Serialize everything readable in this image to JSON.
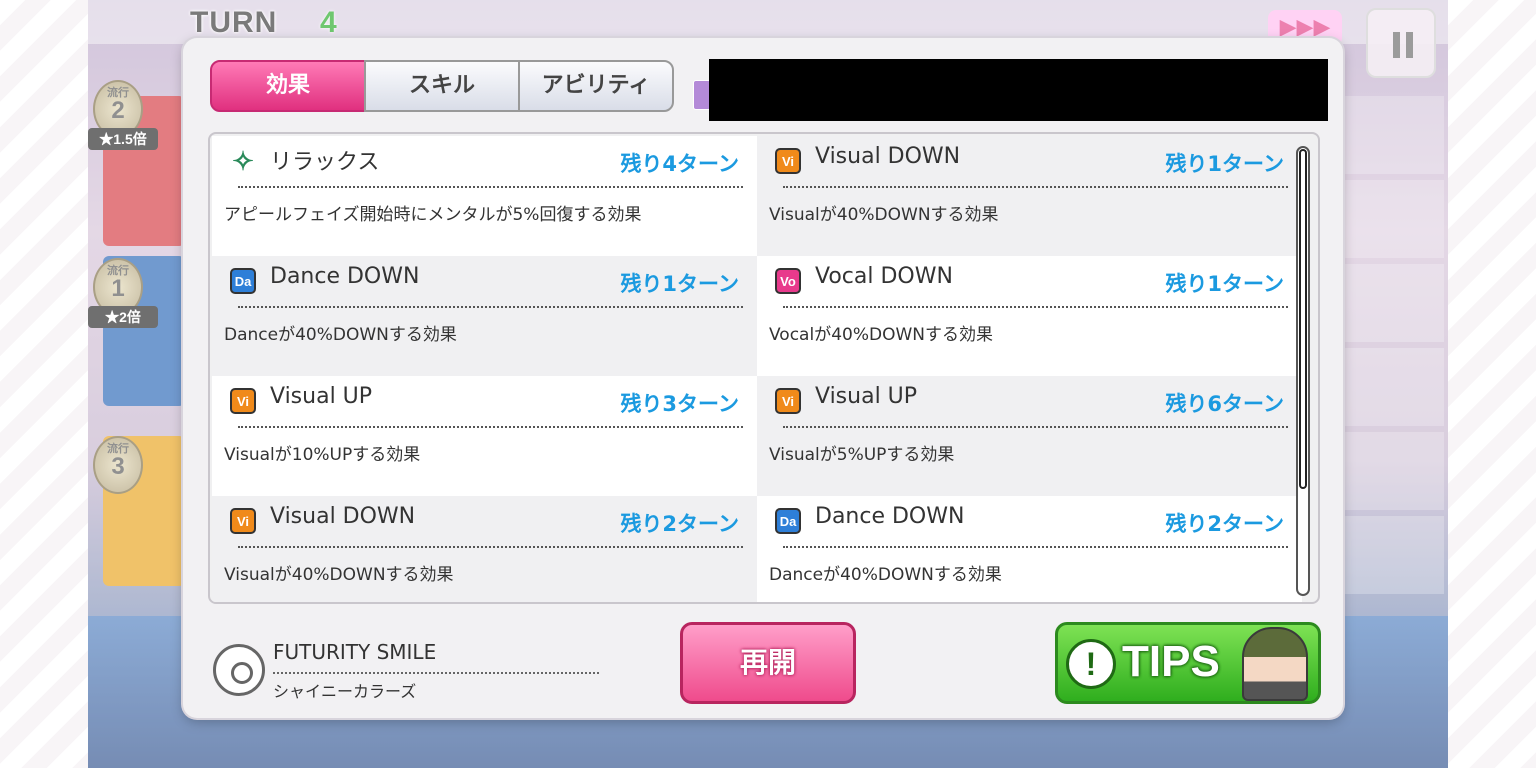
{
  "game": {
    "turn_label": "TURN",
    "turn_number": "4",
    "ffwd_icon": "fast-forward-icon",
    "pause_icon": "pause-icon",
    "trend_label": "流行",
    "slots": [
      {
        "rank": "2",
        "multiplier": "★1.5倍",
        "color": "#d4363e"
      },
      {
        "rank": "1",
        "multiplier": "★2倍",
        "color": "#2664b5"
      },
      {
        "rank": "3",
        "multiplier": "",
        "color": "#e8a219"
      }
    ]
  },
  "modal": {
    "tabs": [
      {
        "label": "効果",
        "active": true
      },
      {
        "label": "スキル",
        "active": false
      },
      {
        "label": "アビリティ",
        "active": false
      }
    ],
    "effects": [
      {
        "icon": "relax-icon",
        "name": "リラックス",
        "turns": "残り4ターン",
        "description": "アピールフェイズ開始時にメンタルが5%回復する効果"
      },
      {
        "icon": "visual-icon",
        "name": "Visual DOWN",
        "turns": "残り1ターン",
        "description": "Visualが40%DOWNする効果"
      },
      {
        "icon": "dance-icon",
        "name": "Dance DOWN",
        "turns": "残り1ターン",
        "description": "Danceが40%DOWNする効果"
      },
      {
        "icon": "vocal-icon",
        "name": "Vocal DOWN",
        "turns": "残り1ターン",
        "description": "Vocalが40%DOWNする効果"
      },
      {
        "icon": "visual-icon",
        "name": "Visual UP",
        "turns": "残り3ターン",
        "description": "Visualが10%UPする効果"
      },
      {
        "icon": "visual-icon",
        "name": "Visual UP",
        "turns": "残り6ターン",
        "description": "Visualが5%UPする効果"
      },
      {
        "icon": "visual-icon",
        "name": "Visual DOWN",
        "turns": "残り2ターン",
        "description": "Visualが40%DOWNする効果"
      },
      {
        "icon": "dance-icon",
        "name": "Dance DOWN",
        "turns": "残り2ターン",
        "description": "Danceが40%DOWNする効果"
      }
    ],
    "song": {
      "title": "FUTURITY SMILE",
      "artist": "シャイニーカラーズ"
    },
    "resume_label": "再開",
    "tips_label": "TIPS",
    "tips_bulb": "!"
  },
  "icon_letters": {
    "visual": "Vi",
    "dance": "Da",
    "vocal": "Vo",
    "relax": "✧"
  },
  "colors": {
    "accent_pink": "#e0307f",
    "turns_blue": "#1b9ae0",
    "tips_green": "#2fae1e"
  }
}
